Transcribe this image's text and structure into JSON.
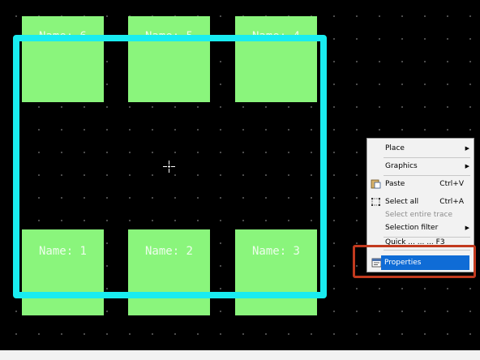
{
  "pads": [
    {
      "label": "Name: 6"
    },
    {
      "label": "Name: 5"
    },
    {
      "label": "Name: 4"
    },
    {
      "label": "Name: 1"
    },
    {
      "label": "Name: 2"
    },
    {
      "label": "Name: 3"
    }
  ],
  "menu": {
    "place": "Place",
    "graphics": "Graphics",
    "paste": "Paste",
    "paste_shortcut": "Ctrl+V",
    "select_all": "Select all",
    "select_all_shortcut": "Ctrl+A",
    "select_entire_trace": "Select entire trace",
    "selection_filter": "Selection filter",
    "quick_item_partial": "Quick ... ... ... F3",
    "properties": "Properties",
    "submenu_arrow": "▶"
  },
  "colors": {
    "canvas_bg": "#000000",
    "grid_dot": "#5a5a5a",
    "outline": "#19ecf0",
    "pad": "#8af57c",
    "menu_selected": "#0f6cd6",
    "callout": "#c23a1e"
  },
  "icons": {
    "paste": "paste-icon",
    "select_all": "select-all-icon",
    "properties": "properties-icon",
    "crosshair": "crosshair-cursor-icon"
  }
}
